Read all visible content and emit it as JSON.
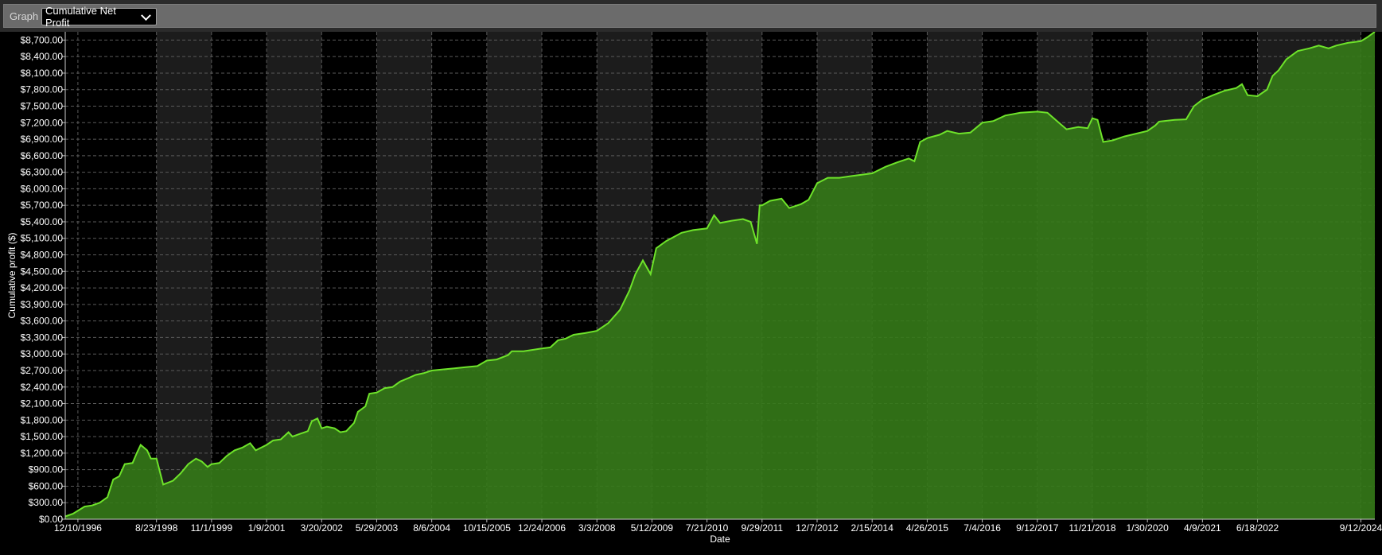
{
  "toolbar": {
    "graph_label": "Graph",
    "selected_view": "Cumulative Net Profit"
  },
  "colors": {
    "background": "#000000",
    "band": "#1c1c1c",
    "fill": "#357a18",
    "line": "#6ee32a",
    "grid": "#5a5a5a"
  },
  "chart_data": {
    "type": "area",
    "title": "",
    "xlabel": "Date",
    "ylabel": "Cumulative profit ($)",
    "ylim": [
      0,
      8850
    ],
    "xlim": [
      "1996-09-01",
      "2024-12-31"
    ],
    "grid": true,
    "y_ticks": [
      "$0.00",
      "$300.00",
      "$600.00",
      "$900.00",
      "$1,200.00",
      "$1,500.00",
      "$1,800.00",
      "$2,100.00",
      "$2,400.00",
      "$2,700.00",
      "$3,000.00",
      "$3,300.00",
      "$3,600.00",
      "$3,900.00",
      "$4,200.00",
      "$4,500.00",
      "$4,800.00",
      "$5,100.00",
      "$5,400.00",
      "$5,700.00",
      "$6,000.00",
      "$6,300.00",
      "$6,600.00",
      "$6,900.00",
      "$7,200.00",
      "$7,500.00",
      "$7,800.00",
      "$8,100.00",
      "$8,400.00",
      "$8,700.00"
    ],
    "x_ticks": [
      {
        "label": "12/10/1996",
        "date": "1996-12-10"
      },
      {
        "label": "8/23/1998",
        "date": "1998-08-23"
      },
      {
        "label": "11/1/1999",
        "date": "1999-11-01"
      },
      {
        "label": "1/9/2001",
        "date": "2001-01-09"
      },
      {
        "label": "3/20/2002",
        "date": "2002-03-20"
      },
      {
        "label": "5/29/2003",
        "date": "2003-05-29"
      },
      {
        "label": "8/6/2004",
        "date": "2004-08-06"
      },
      {
        "label": "10/15/2005",
        "date": "2005-10-15"
      },
      {
        "label": "12/24/2006",
        "date": "2006-12-24"
      },
      {
        "label": "3/3/2008",
        "date": "2008-03-03"
      },
      {
        "label": "5/12/2009",
        "date": "2009-05-12"
      },
      {
        "label": "7/21/2010",
        "date": "2010-07-21"
      },
      {
        "label": "9/29/2011",
        "date": "2011-09-29"
      },
      {
        "label": "12/7/2012",
        "date": "2012-12-07"
      },
      {
        "label": "2/15/2014",
        "date": "2014-02-15"
      },
      {
        "label": "4/26/2015",
        "date": "2015-04-26"
      },
      {
        "label": "7/4/2016",
        "date": "2016-07-04"
      },
      {
        "label": "9/12/2017",
        "date": "2017-09-12"
      },
      {
        "label": "11/21/2018",
        "date": "2018-11-21"
      },
      {
        "label": "1/30/2020",
        "date": "2020-01-30"
      },
      {
        "label": "4/9/2021",
        "date": "2021-04-09"
      },
      {
        "label": "6/18/2022",
        "date": "2022-06-18"
      },
      {
        "label": "9/12/2024",
        "date": "2024-09-12"
      }
    ],
    "series": [
      {
        "values": [
          {
            "x": "1996-09-01",
            "y": 50
          },
          {
            "x": "1996-11-01",
            "y": 100
          },
          {
            "x": "1997-02-01",
            "y": 230
          },
          {
            "x": "1997-04-01",
            "y": 250
          },
          {
            "x": "1997-06-01",
            "y": 300
          },
          {
            "x": "1997-08-01",
            "y": 400
          },
          {
            "x": "1997-09-15",
            "y": 720
          },
          {
            "x": "1997-11-01",
            "y": 780
          },
          {
            "x": "1997-12-15",
            "y": 1000
          },
          {
            "x": "1998-02-15",
            "y": 1020
          },
          {
            "x": "1998-03-20",
            "y": 1200
          },
          {
            "x": "1998-04-20",
            "y": 1350
          },
          {
            "x": "1998-06-10",
            "y": 1250
          },
          {
            "x": "1998-07-10",
            "y": 1100
          },
          {
            "x": "1998-08-23",
            "y": 1100
          },
          {
            "x": "1998-10-15",
            "y": 630
          },
          {
            "x": "1999-01-01",
            "y": 700
          },
          {
            "x": "1999-03-01",
            "y": 830
          },
          {
            "x": "1999-05-01",
            "y": 1000
          },
          {
            "x": "1999-07-01",
            "y": 1100
          },
          {
            "x": "1999-08-15",
            "y": 1050
          },
          {
            "x": "1999-10-01",
            "y": 950
          },
          {
            "x": "1999-11-01",
            "y": 1000
          },
          {
            "x": "2000-01-01",
            "y": 1020
          },
          {
            "x": "2000-03-01",
            "y": 1150
          },
          {
            "x": "2000-05-01",
            "y": 1250
          },
          {
            "x": "2000-07-01",
            "y": 1300
          },
          {
            "x": "2000-09-01",
            "y": 1380
          },
          {
            "x": "2000-10-15",
            "y": 1250
          },
          {
            "x": "2001-01-09",
            "y": 1350
          },
          {
            "x": "2001-03-01",
            "y": 1430
          },
          {
            "x": "2001-05-01",
            "y": 1450
          },
          {
            "x": "2001-07-01",
            "y": 1580
          },
          {
            "x": "2001-08-01",
            "y": 1500
          },
          {
            "x": "2001-10-01",
            "y": 1550
          },
          {
            "x": "2001-12-01",
            "y": 1600
          },
          {
            "x": "2002-01-01",
            "y": 1780
          },
          {
            "x": "2002-02-15",
            "y": 1830
          },
          {
            "x": "2002-03-20",
            "y": 1650
          },
          {
            "x": "2002-05-01",
            "y": 1680
          },
          {
            "x": "2002-07-01",
            "y": 1650
          },
          {
            "x": "2002-08-15",
            "y": 1580
          },
          {
            "x": "2002-10-01",
            "y": 1600
          },
          {
            "x": "2002-12-01",
            "y": 1750
          },
          {
            "x": "2003-01-01",
            "y": 1950
          },
          {
            "x": "2003-03-01",
            "y": 2050
          },
          {
            "x": "2003-04-01",
            "y": 2280
          },
          {
            "x": "2003-05-29",
            "y": 2300
          },
          {
            "x": "2003-08-01",
            "y": 2380
          },
          {
            "x": "2003-10-01",
            "y": 2400
          },
          {
            "x": "2003-12-01",
            "y": 2500
          },
          {
            "x": "2004-02-01",
            "y": 2560
          },
          {
            "x": "2004-04-01",
            "y": 2620
          },
          {
            "x": "2004-06-01",
            "y": 2650
          },
          {
            "x": "2004-08-06",
            "y": 2700
          },
          {
            "x": "2004-11-01",
            "y": 2720
          },
          {
            "x": "2005-02-01",
            "y": 2740
          },
          {
            "x": "2005-05-01",
            "y": 2760
          },
          {
            "x": "2005-08-01",
            "y": 2780
          },
          {
            "x": "2005-10-15",
            "y": 2880
          },
          {
            "x": "2006-01-01",
            "y": 2900
          },
          {
            "x": "2006-04-01",
            "y": 2980
          },
          {
            "x": "2006-05-01",
            "y": 3050
          },
          {
            "x": "2006-08-01",
            "y": 3050
          },
          {
            "x": "2006-12-24",
            "y": 3100
          },
          {
            "x": "2007-03-01",
            "y": 3120
          },
          {
            "x": "2007-05-01",
            "y": 3250
          },
          {
            "x": "2007-07-01",
            "y": 3280
          },
          {
            "x": "2007-09-01",
            "y": 3350
          },
          {
            "x": "2007-12-01",
            "y": 3380
          },
          {
            "x": "2008-03-03",
            "y": 3420
          },
          {
            "x": "2008-06-01",
            "y": 3560
          },
          {
            "x": "2008-09-01",
            "y": 3800
          },
          {
            "x": "2008-11-15",
            "y": 4150
          },
          {
            "x": "2009-01-01",
            "y": 4450
          },
          {
            "x": "2009-03-01",
            "y": 4700
          },
          {
            "x": "2009-05-01",
            "y": 4450
          },
          {
            "x": "2009-06-15",
            "y": 4920
          },
          {
            "x": "2009-09-01",
            "y": 5050
          },
          {
            "x": "2010-01-01",
            "y": 5200
          },
          {
            "x": "2010-04-01",
            "y": 5250
          },
          {
            "x": "2010-07-21",
            "y": 5280
          },
          {
            "x": "2010-09-15",
            "y": 5520
          },
          {
            "x": "2010-11-01",
            "y": 5380
          },
          {
            "x": "2011-02-01",
            "y": 5420
          },
          {
            "x": "2011-05-01",
            "y": 5450
          },
          {
            "x": "2011-07-01",
            "y": 5400
          },
          {
            "x": "2011-08-20",
            "y": 5000
          },
          {
            "x": "2011-09-10",
            "y": 5700
          },
          {
            "x": "2011-09-29",
            "y": 5700
          },
          {
            "x": "2011-12-01",
            "y": 5780
          },
          {
            "x": "2012-03-01",
            "y": 5820
          },
          {
            "x": "2012-05-01",
            "y": 5650
          },
          {
            "x": "2012-08-01",
            "y": 5720
          },
          {
            "x": "2012-10-01",
            "y": 5800
          },
          {
            "x": "2012-12-07",
            "y": 6100
          },
          {
            "x": "2013-03-01",
            "y": 6200
          },
          {
            "x": "2013-06-01",
            "y": 6200
          },
          {
            "x": "2013-09-01",
            "y": 6230
          },
          {
            "x": "2014-02-15",
            "y": 6280
          },
          {
            "x": "2014-06-01",
            "y": 6400
          },
          {
            "x": "2014-09-01",
            "y": 6480
          },
          {
            "x": "2014-12-01",
            "y": 6550
          },
          {
            "x": "2015-01-15",
            "y": 6500
          },
          {
            "x": "2015-03-01",
            "y": 6850
          },
          {
            "x": "2015-04-26",
            "y": 6920
          },
          {
            "x": "2015-08-01",
            "y": 6980
          },
          {
            "x": "2015-10-01",
            "y": 7050
          },
          {
            "x": "2016-01-01",
            "y": 7000
          },
          {
            "x": "2016-04-01",
            "y": 7020
          },
          {
            "x": "2016-07-04",
            "y": 7200
          },
          {
            "x": "2016-10-01",
            "y": 7230
          },
          {
            "x": "2017-01-01",
            "y": 7330
          },
          {
            "x": "2017-05-01",
            "y": 7380
          },
          {
            "x": "2017-09-12",
            "y": 7400
          },
          {
            "x": "2017-12-01",
            "y": 7380
          },
          {
            "x": "2018-03-01",
            "y": 7200
          },
          {
            "x": "2018-05-01",
            "y": 7080
          },
          {
            "x": "2018-08-01",
            "y": 7120
          },
          {
            "x": "2018-10-15",
            "y": 7100
          },
          {
            "x": "2018-11-21",
            "y": 7280
          },
          {
            "x": "2019-01-01",
            "y": 7250
          },
          {
            "x": "2019-02-15",
            "y": 6850
          },
          {
            "x": "2019-05-01",
            "y": 6880
          },
          {
            "x": "2019-08-01",
            "y": 6950
          },
          {
            "x": "2019-11-01",
            "y": 7000
          },
          {
            "x": "2020-01-30",
            "y": 7050
          },
          {
            "x": "2020-04-01",
            "y": 7150
          },
          {
            "x": "2020-05-01",
            "y": 7220
          },
          {
            "x": "2020-09-01",
            "y": 7250
          },
          {
            "x": "2020-12-01",
            "y": 7260
          },
          {
            "x": "2021-02-01",
            "y": 7500
          },
          {
            "x": "2021-04-09",
            "y": 7620
          },
          {
            "x": "2021-07-01",
            "y": 7700
          },
          {
            "x": "2021-10-01",
            "y": 7780
          },
          {
            "x": "2022-01-01",
            "y": 7830
          },
          {
            "x": "2022-02-15",
            "y": 7900
          },
          {
            "x": "2022-04-01",
            "y": 7700
          },
          {
            "x": "2022-06-18",
            "y": 7680
          },
          {
            "x": "2022-09-01",
            "y": 7800
          },
          {
            "x": "2022-10-15",
            "y": 8050
          },
          {
            "x": "2022-12-01",
            "y": 8150
          },
          {
            "x": "2023-02-01",
            "y": 8350
          },
          {
            "x": "2023-05-01",
            "y": 8500
          },
          {
            "x": "2023-08-01",
            "y": 8550
          },
          {
            "x": "2023-10-15",
            "y": 8600
          },
          {
            "x": "2024-01-01",
            "y": 8550
          },
          {
            "x": "2024-03-01",
            "y": 8600
          },
          {
            "x": "2024-06-01",
            "y": 8650
          },
          {
            "x": "2024-09-12",
            "y": 8680
          },
          {
            "x": "2024-11-01",
            "y": 8750
          },
          {
            "x": "2024-12-31",
            "y": 8850
          }
        ]
      }
    ]
  }
}
